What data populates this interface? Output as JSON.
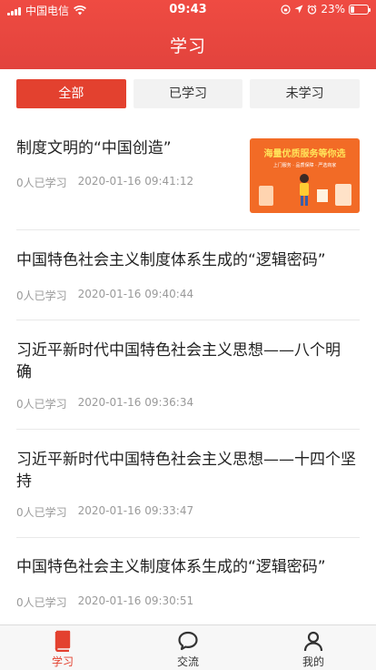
{
  "status_bar": {
    "carrier": "中国电信",
    "time": "09:43",
    "battery": "23%",
    "battery_level": 0.23,
    "icons": [
      "signal-icon",
      "wifi-icon",
      "lock-rotation-icon",
      "location-icon",
      "alarm-icon",
      "battery-icon"
    ]
  },
  "header": {
    "title": "学习",
    "background_color": "#e8453d"
  },
  "filter_tabs": [
    {
      "label": "全部",
      "active": true
    },
    {
      "label": "已学习",
      "active": false
    },
    {
      "label": "未学习",
      "active": false
    }
  ],
  "articles": [
    {
      "title": "制度文明的“中国创造”",
      "readers": "0人已学习",
      "date": "2020-01-16 09:41:12",
      "thumbnail": {
        "headline": "海量优质服务等你选",
        "subtitle": "上门服务 · 品质保障 · 严选商家"
      }
    },
    {
      "title": "中国特色社会主义制度体系生成的“逻辑密码”",
      "readers": "0人已学习",
      "date": "2020-01-16 09:40:44"
    },
    {
      "title": "习近平新时代中国特色社会主义思想——八个明确",
      "readers": "0人已学习",
      "date": "2020-01-16 09:36:34"
    },
    {
      "title": "习近平新时代中国特色社会主义思想——十四个坚持",
      "readers": "0人已学习",
      "date": "2020-01-16 09:33:47"
    },
    {
      "title": "中国特色社会主义制度体系生成的“逻辑密码”",
      "readers": "0人已学习",
      "date": "2020-01-16 09:30:51"
    }
  ],
  "tabbar": [
    {
      "label": "学习",
      "icon": "book-icon",
      "active": true
    },
    {
      "label": "交流",
      "icon": "chat-bubble-icon",
      "active": false
    },
    {
      "label": "我的",
      "icon": "user-icon",
      "active": false
    }
  ],
  "colors": {
    "accent": "#e3412f",
    "meta_text": "#9a9a9a",
    "thumbnail_bg": "#f26b26"
  }
}
